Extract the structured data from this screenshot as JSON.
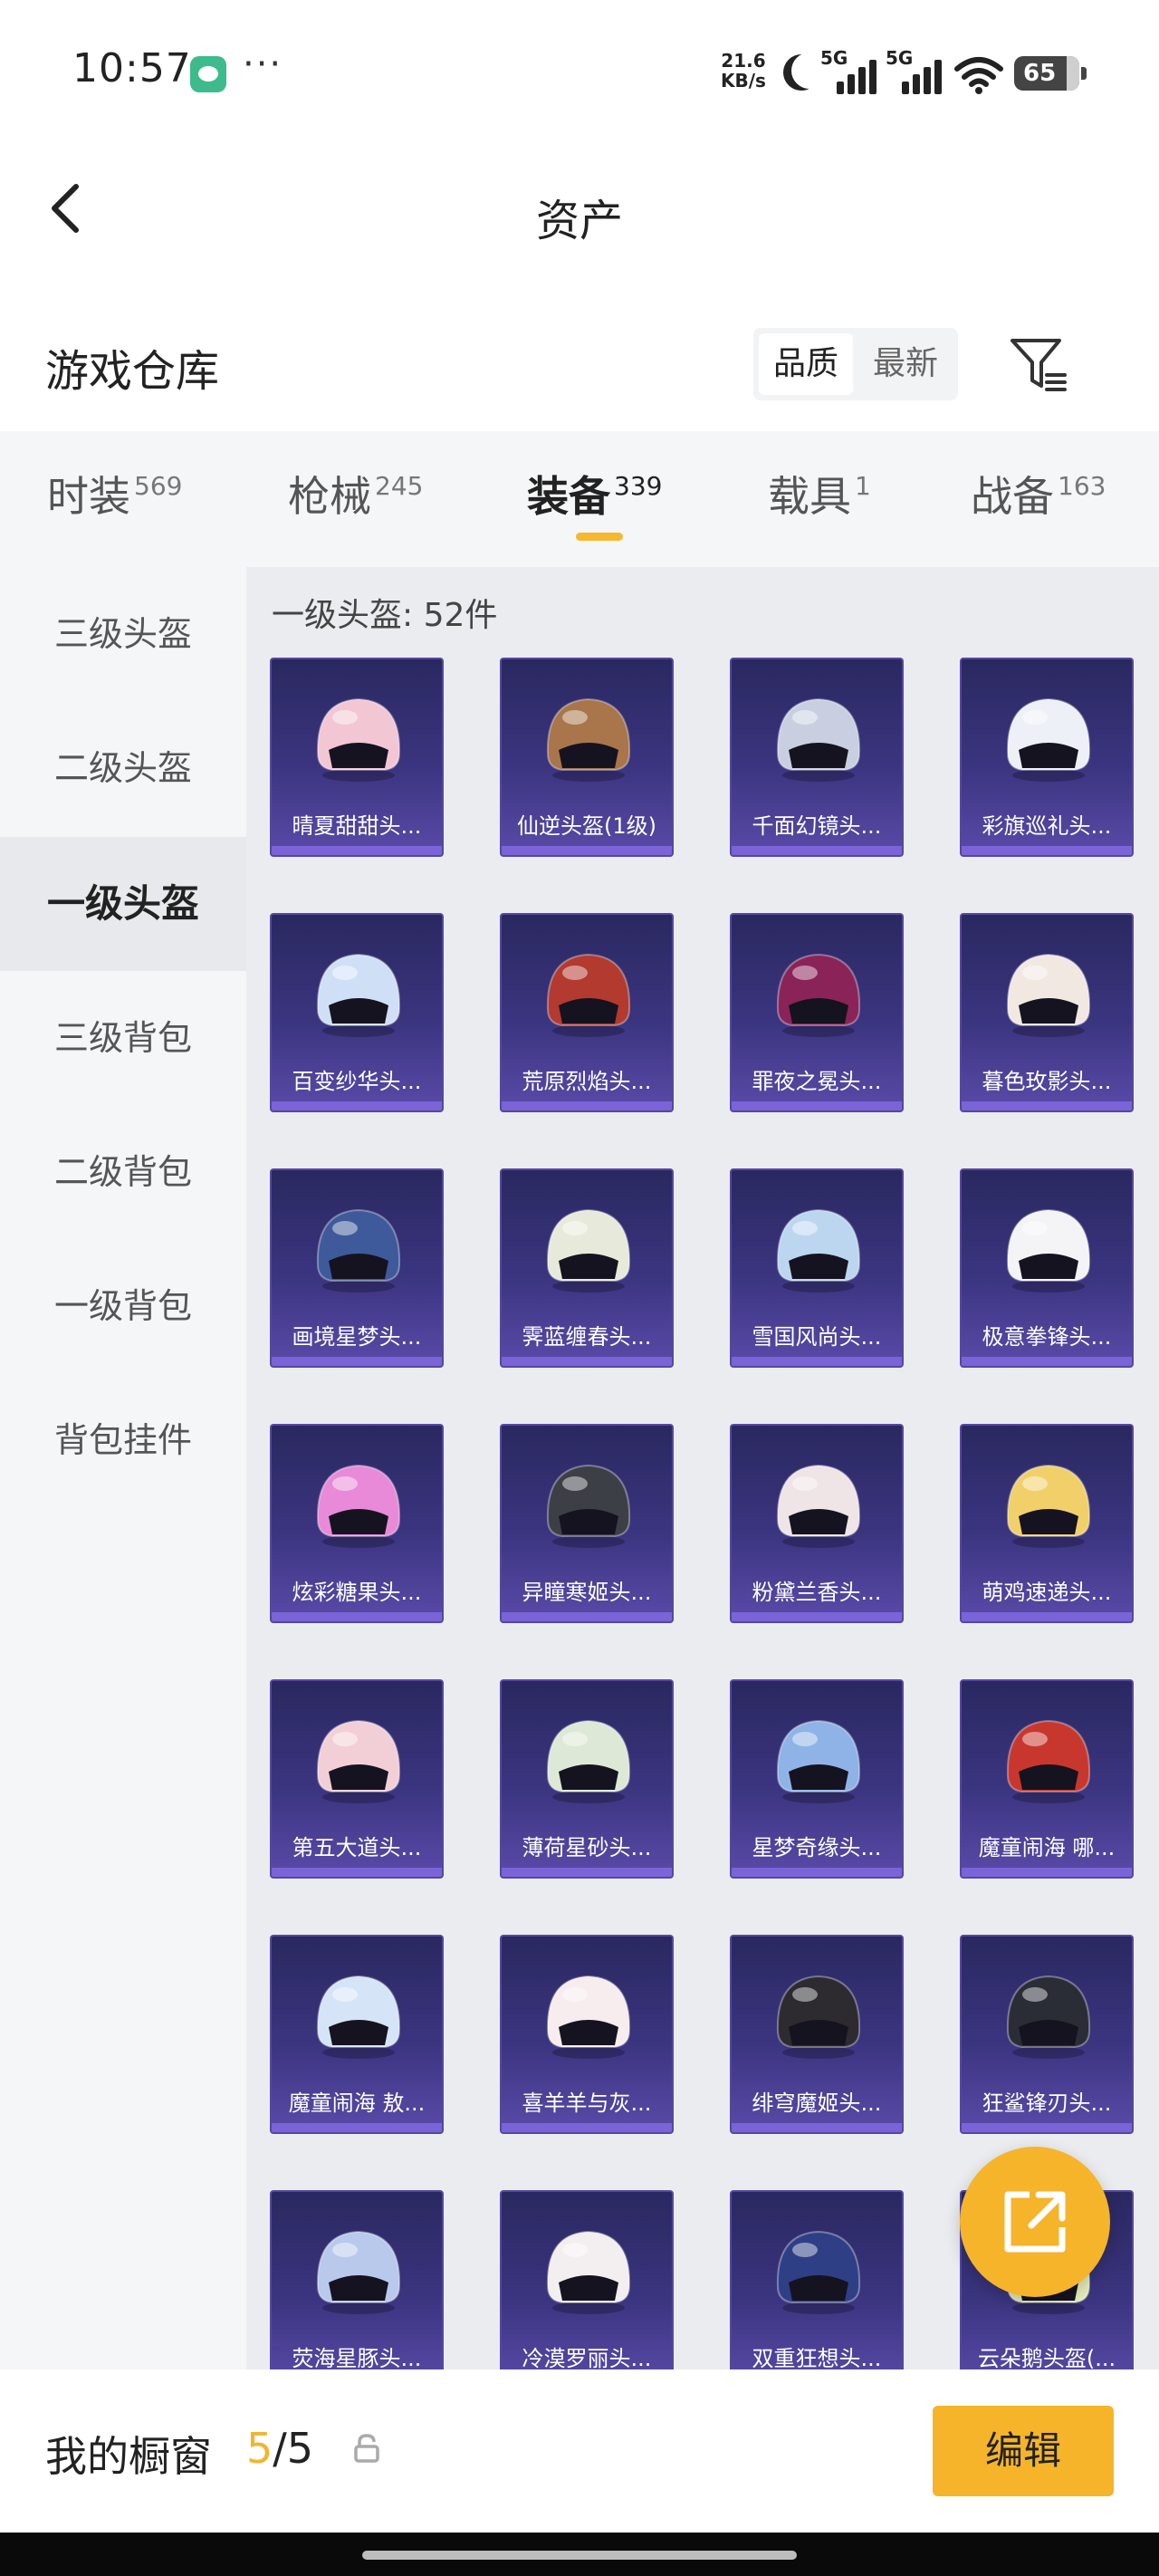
{
  "status_bar": {
    "time": "10:57",
    "more": "···",
    "net_speed_value": "21.6",
    "net_speed_unit": "KB/s",
    "sim1": "5G",
    "sim2": "5G",
    "battery": "65"
  },
  "nav": {
    "title": "资产"
  },
  "section": {
    "title": "游戏仓库",
    "sort_options": [
      "品质",
      "最新"
    ],
    "selected_sort": "品质"
  },
  "tabs": [
    {
      "label": "时装",
      "count": "569"
    },
    {
      "label": "枪械",
      "count": "245"
    },
    {
      "label": "装备",
      "count": "339"
    },
    {
      "label": "载具",
      "count": "1"
    },
    {
      "label": "战备",
      "count": "163"
    }
  ],
  "active_tab": "装备",
  "sidebar": [
    {
      "label": "三级头盔"
    },
    {
      "label": "二级头盔"
    },
    {
      "label": "一级头盔"
    },
    {
      "label": "三级背包"
    },
    {
      "label": "二级背包"
    },
    {
      "label": "一级背包"
    },
    {
      "label": "背包挂件"
    }
  ],
  "active_sidebar": "一级头盔",
  "content": {
    "subtitle": "一级头盔: 52件",
    "items": [
      {
        "name": "晴夏甜甜头...",
        "color": "#f3c6d3"
      },
      {
        "name": "仙逆头盔(1级)",
        "color": "#a8764a"
      },
      {
        "name": "千面幻镜头...",
        "color": "#c9cfe0"
      },
      {
        "name": "彩旗巡礼头...",
        "color": "#eef0f8"
      },
      {
        "name": "百变纱华头...",
        "color": "#cfe0f6"
      },
      {
        "name": "荒原烈焰头...",
        "color": "#b33a2e"
      },
      {
        "name": "罪夜之冕头...",
        "color": "#8a2458"
      },
      {
        "name": "暮色玫影头...",
        "color": "#f1e8e2"
      },
      {
        "name": "画境星梦头...",
        "color": "#3f5a9a"
      },
      {
        "name": "霁蓝缠春头...",
        "color": "#e7eadb"
      },
      {
        "name": "雪国风尚头...",
        "color": "#bcd6f0"
      },
      {
        "name": "极意拳锋头...",
        "color": "#f4f4f6"
      },
      {
        "name": "炫彩糖果头...",
        "color": "#e88ad8"
      },
      {
        "name": "异瞳寒姬头...",
        "color": "#3d3f46"
      },
      {
        "name": "粉黛兰香头...",
        "color": "#efe4e6"
      },
      {
        "name": "萌鸡速递头...",
        "color": "#f1d069"
      },
      {
        "name": "第五大道头...",
        "color": "#f2cfd6"
      },
      {
        "name": "薄荷星砂头...",
        "color": "#dde8d6"
      },
      {
        "name": "星梦奇缘头...",
        "color": "#8fb3e6"
      },
      {
        "name": "魔童闹海 哪...",
        "color": "#c8372d"
      },
      {
        "name": "魔童闹海 敖...",
        "color": "#d5e4f7"
      },
      {
        "name": "喜羊羊与灰...",
        "color": "#f7ecee"
      },
      {
        "name": "绯穹魔姬头...",
        "color": "#2d2a30"
      },
      {
        "name": "狂鲨锋刃头...",
        "color": "#2a2d36"
      },
      {
        "name": "荧海星豚头...",
        "color": "#b8c9ec"
      },
      {
        "name": "冷漠罗丽头...",
        "color": "#f3eef0"
      },
      {
        "name": "双重狂想头...",
        "color": "#2e3f86"
      },
      {
        "name": "云朵鹅头盔(...",
        "color": "#e4ecb6"
      }
    ]
  },
  "bottom_bar": {
    "label": "我的橱窗",
    "count_current": "5",
    "count_sep": "/",
    "count_total": "5",
    "edit_label": "编辑"
  },
  "colors": {
    "accent": "#f5b42a",
    "card_bg": "#3b3580"
  }
}
